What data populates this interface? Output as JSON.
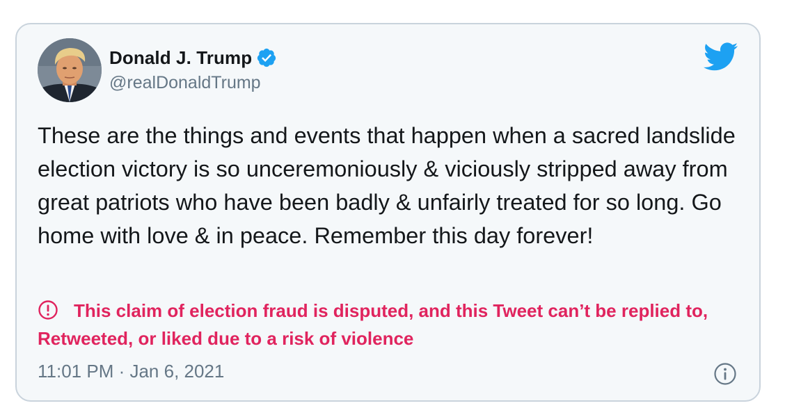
{
  "tweet": {
    "author": {
      "display_name": "Donald J. Trump",
      "handle": "@realDonaldTrump",
      "verified": true,
      "avatar_icon": "profile-photo",
      "verified_icon": "verified-badge-icon"
    },
    "text": "These are the things and events that happen when a sacred landslide election victory is so unceremoniously & viciously stripped away from great patriots who have been badly & unfairly treated for so long. Go home with love & in peace. Remember this day forever!",
    "notice": {
      "icon": "warning-icon",
      "text": "This claim of election fraud is disputed, and this Tweet can’t be replied to, Retweeted, or liked due to a risk of violence"
    },
    "timestamp": "11:01 PM · Jan 6, 2021",
    "brand_icon": "twitter-bird-icon",
    "info_icon": "info-icon"
  },
  "colors": {
    "card_background": "#f5f8fa",
    "card_border": "#c9d3dc",
    "text_primary": "#14171a",
    "text_secondary": "#657786",
    "notice_red": "#e0245e",
    "twitter_blue": "#1da1f2"
  }
}
